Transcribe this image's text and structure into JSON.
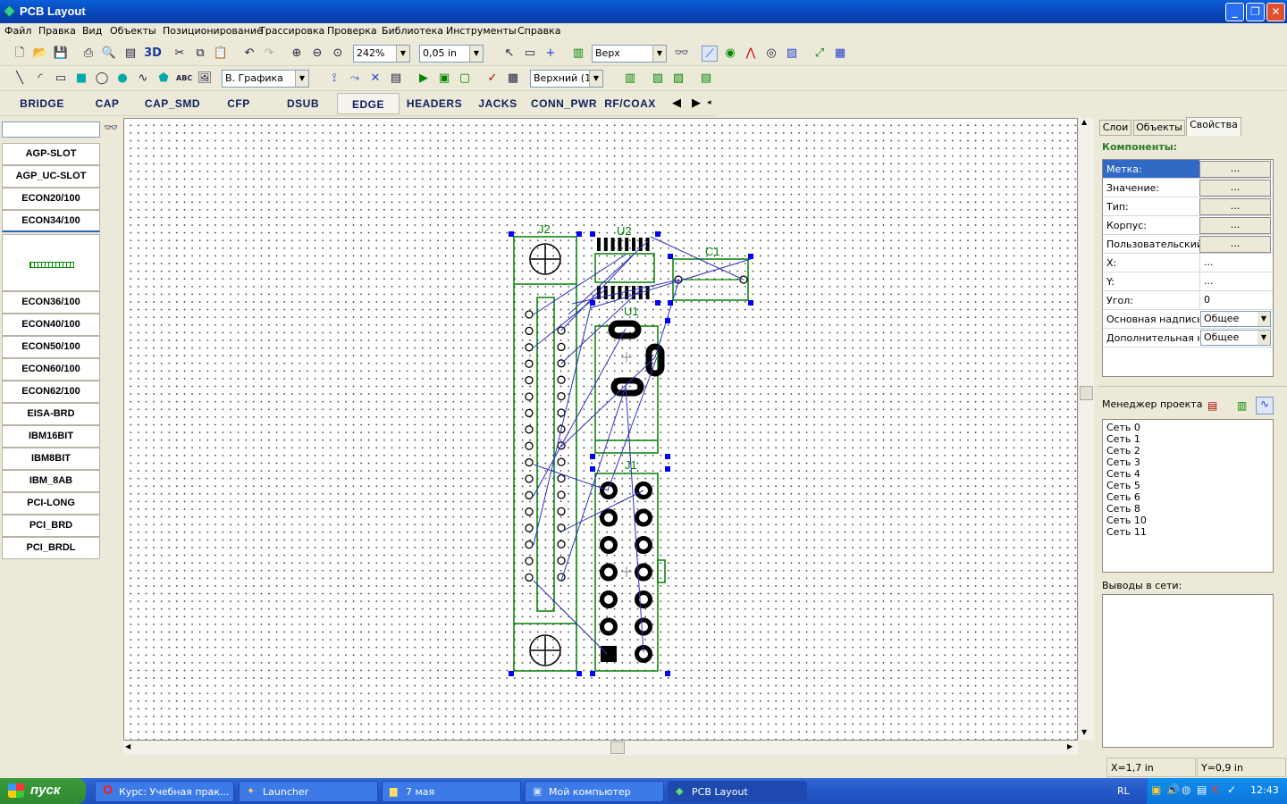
{
  "app": {
    "title": "PCB Layout"
  },
  "window_buttons": [
    "_",
    "❐",
    "✕"
  ],
  "menu": [
    "Файл",
    "Правка",
    "Вид",
    "Объекты",
    "Позиционирование",
    "Трассировка",
    "Проверка",
    "Библиотека",
    "Инструменты",
    "Справка"
  ],
  "toolbar1": {
    "label_3d": "3D",
    "zoom": "242%",
    "grid": "0,05 in",
    "layer": "Верх"
  },
  "toolbar2": {
    "abc": "ABC",
    "graphics_layer": "В. Графика",
    "copper_layer": "Верхний (1)"
  },
  "library_tabs": [
    "BRIDGE",
    "CAP",
    "CAP_SMD",
    "CFP",
    "DSUB",
    "EDGE",
    "HEADERS",
    "JACKS",
    "CONN_PWR",
    "RF/COAX"
  ],
  "library_items": [
    "AGP-SLOT",
    "AGP_UC-SLOT",
    "ECON20/100",
    "ECON34/100",
    "ECON36/100",
    "ECON40/100",
    "ECON50/100",
    "ECON60/100",
    "ECON62/100",
    "EISA-BRD",
    "IBM16BIT",
    "IBM8BIT",
    "IBM_8AB",
    "PCI-LONG",
    "PCI_BRD",
    "PCI_BRDL"
  ],
  "components": {
    "j2": "J2",
    "u2": "U2",
    "c1": "C1",
    "u1": "U1",
    "j1": "J1"
  },
  "right_tabs": [
    "Слои",
    "Объекты",
    "Свойства"
  ],
  "properties": {
    "header": "Компоненты:",
    "rows": [
      {
        "label": "Метка:",
        "btn": "..."
      },
      {
        "label": "Значение:",
        "btn": "..."
      },
      {
        "label": "Тип:",
        "btn": "..."
      },
      {
        "label": "Корпус:",
        "btn": "..."
      },
      {
        "label": "Пользовательский:",
        "btn": "..."
      },
      {
        "label": "X:",
        "value": "..."
      },
      {
        "label": "Y:",
        "value": "..."
      },
      {
        "label": "Угол:",
        "value": "0"
      },
      {
        "label": "Основная надпись:",
        "combo": "Общее"
      },
      {
        "label": "Дополнительная надпись:",
        "combo": "Общее"
      }
    ]
  },
  "project_manager": {
    "title": "Менеджер проекта",
    "nets": [
      "Сеть 0",
      "Сеть 1",
      "Сеть 2",
      "Сеть 3",
      "Сеть 4",
      "Сеть 5",
      "Сеть 6",
      "Сеть 8",
      "Сеть 10",
      "Сеть 11"
    ],
    "pins_label": "Выводы в сети:"
  },
  "status": {
    "x": "X=1,7 in",
    "y": "Y=0,9 in"
  },
  "taskbar": {
    "start": "пуск",
    "tasks": [
      "Курс: Учебная прак...",
      "Launcher",
      "7 мая",
      "Мой компьютер",
      "PCB Layout"
    ],
    "lang": "RL",
    "clock": "12:43"
  },
  "colors": {
    "board_outline": "#008000",
    "ratsnest": "#3030c0",
    "selection": "#0000ff"
  }
}
